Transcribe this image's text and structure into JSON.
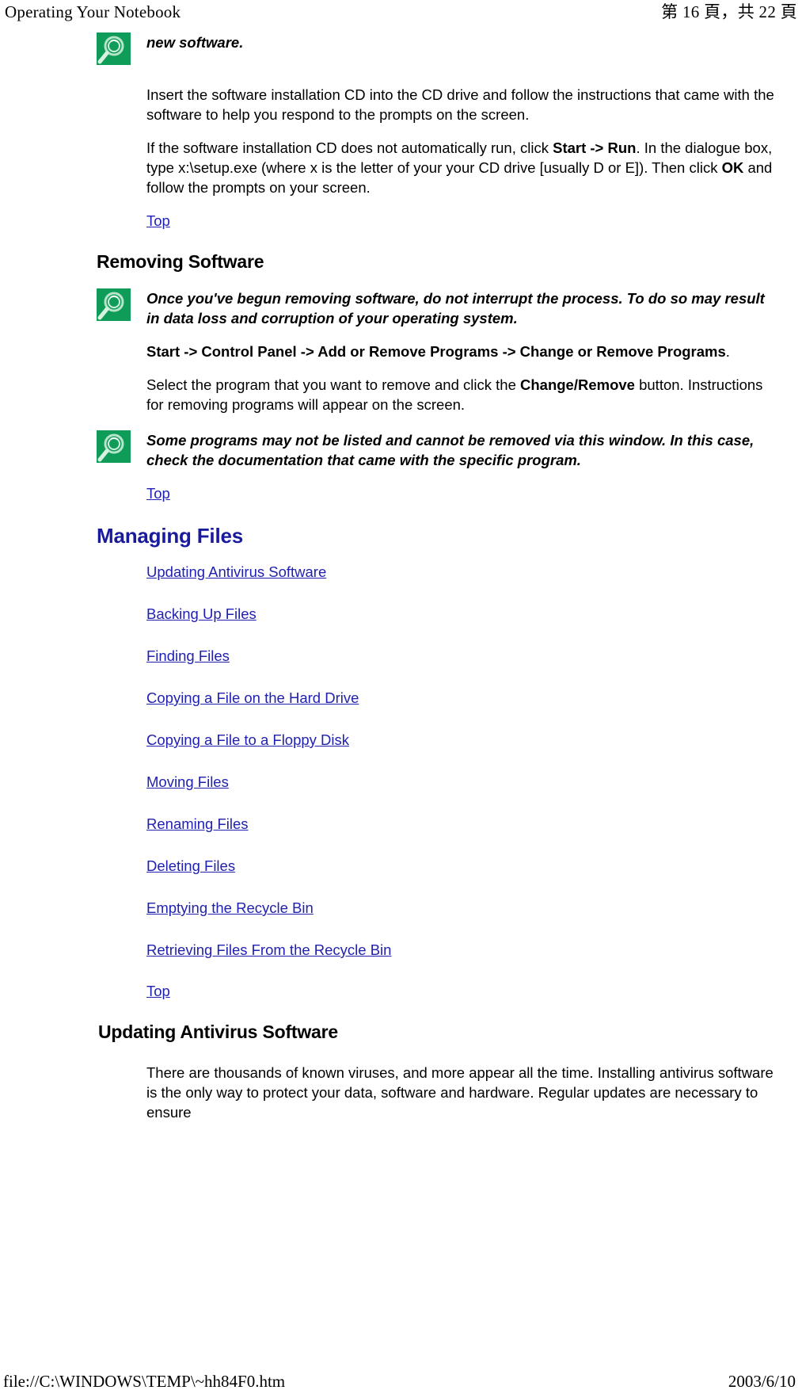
{
  "header": {
    "title": "Operating Your Notebook",
    "page_indicator": "第 16 頁，共 22 頁"
  },
  "footer": {
    "file_path": "file://C:\\WINDOWS\\TEMP\\~hh84F0.htm",
    "date": "2003/6/10"
  },
  "colors": {
    "link": "#2121b0",
    "heading_blue": "#1a1a9c",
    "icon_green": "#0ea05a",
    "text": "#000000"
  },
  "content": {
    "note_top": {
      "icon": "magnifier-note-icon",
      "text": "new software."
    },
    "para_insert_cd": "Insert the software installation CD into the CD drive and follow the instructions that came with the software to help you respond to the prompts on the screen.",
    "para_autorun": {
      "part1": "If the software installation CD does not automatically run, click ",
      "bold1": "Start -> Run",
      "part2": ". In the dialogue box, type x:\\setup.exe (where x is the letter of your your CD drive [usually D or E]). Then click ",
      "bold2": "OK",
      "part3": " and follow the prompts on your screen."
    },
    "top_link_1": "Top",
    "heading_removing_software": "Removing Software",
    "note_removing": {
      "icon": "magnifier-note-icon",
      "text": "Once you've begun removing software, do not interrupt the process. To do so may result in data loss and corruption of your operating system."
    },
    "para_path": {
      "bold": "Start -> Control Panel -> Add or Remove Programs -> Change or Remove Programs",
      "tail": "."
    },
    "para_select_program": {
      "part1": "Select the program that you want to remove and click the ",
      "bold1": "Change/Remove",
      "part2": " button. Instructions for removing programs will appear on the screen."
    },
    "note_some_programs": {
      "icon": "magnifier-note-icon",
      "text": "Some programs may not be listed and cannot be removed via this window. In this case, check the documentation that came with the specific program."
    },
    "top_link_2": "Top",
    "heading_managing_files": "Managing Files",
    "managing_files_links": [
      "Updating Antivirus Software",
      "Backing Up Files",
      "Finding Files",
      "Copying a File on the Hard Drive",
      "Copying a File to a Floppy Disk",
      "Moving Files",
      "Renaming Files",
      "Deleting Files",
      "Emptying the Recycle Bin",
      "Retrieving Files From the Recycle Bin"
    ],
    "top_link_3": "Top",
    "heading_updating_antivirus": "Updating Antivirus Software",
    "para_viruses": "There are thousands of known viruses, and more appear all the time. Installing antivirus software is the only way to protect your data, software and hardware. Regular updates are necessary to ensure"
  }
}
